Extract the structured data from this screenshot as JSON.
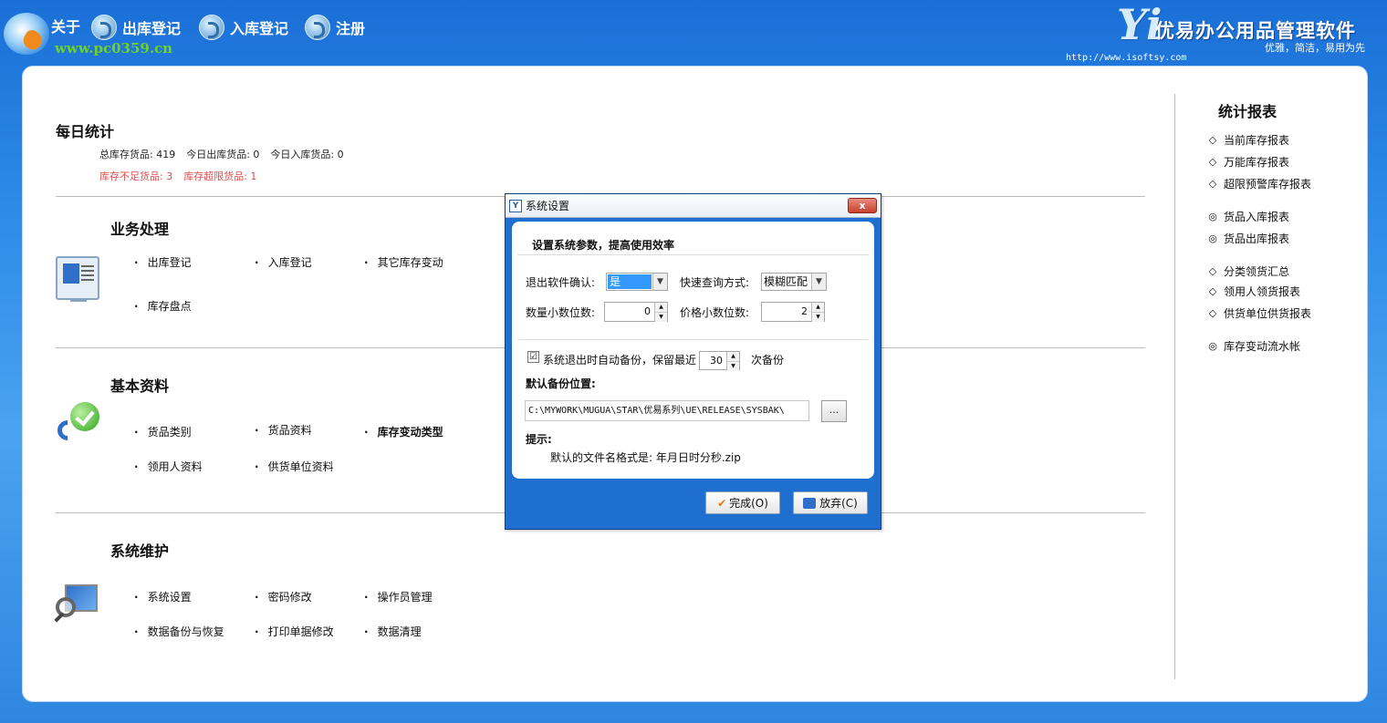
{
  "topbar": {
    "nav": [
      {
        "label": "关于"
      },
      {
        "label": "出库登记"
      },
      {
        "label": "入库登记"
      },
      {
        "label": "注册"
      }
    ],
    "watermark": "www.pc0359.cn",
    "brand": {
      "logo_letter": "Yi",
      "name": "优易办公用品管理软件",
      "slogan": "优雅，简洁，易用为先",
      "url": "http://www.isoftsy.com"
    }
  },
  "daily": {
    "title": "每日统计",
    "line1": [
      "总库存货品: 419",
      "今日出库货品: 0",
      "今日入库货品: 0"
    ],
    "line2": [
      "库存不足货品: 3",
      "库存超限货品: 1"
    ]
  },
  "business": {
    "title": "业务处理",
    "items": [
      "出库登记",
      "入库登记",
      "其它库存变动",
      "库存盘点"
    ]
  },
  "basic": {
    "title": "基本资料",
    "items": [
      "货品类别",
      "货品资料",
      "库存变动类型",
      "领用人资料",
      "供货单位资料"
    ]
  },
  "maintenance": {
    "title": "系统维护",
    "items": [
      "系统设置",
      "密码修改",
      "操作员管理",
      "数据备份与恢复",
      "打印单据修改",
      "数据清理"
    ]
  },
  "reports": {
    "title": "统计报表",
    "items": [
      {
        "mark": "◇",
        "label": "当前库存报表"
      },
      {
        "mark": "◇",
        "label": "万能库存报表"
      },
      {
        "mark": "◇",
        "label": "超限预警库存报表"
      },
      {
        "mark": "◎",
        "label": "货品入库报表"
      },
      {
        "mark": "◎",
        "label": "货品出库报表"
      },
      {
        "mark": "◇",
        "label": "分类领货汇总"
      },
      {
        "mark": "◇",
        "label": "领用人领货报表"
      },
      {
        "mark": "◇",
        "label": "供货单位供货报表"
      },
      {
        "mark": "◎",
        "label": "库存变动流水帐"
      }
    ]
  },
  "dialog": {
    "title": "系统设置",
    "close": "x",
    "subtitle": "设置系统参数，提高使用效率",
    "exit_confirm_label": "退出软件确认:",
    "exit_confirm_value": "是",
    "query_mode_label": "快速查询方式:",
    "query_mode_value": "模糊匹配",
    "qty_decimals_label": "数量小数位数:",
    "qty_decimals_value": "0",
    "price_decimals_label": "价格小数位数:",
    "price_decimals_value": "2",
    "auto_backup_label": "系统退出时自动备份，保留最近",
    "auto_backup_checked": "☑",
    "backup_keep_value": "30",
    "backup_keep_suffix": "次备份",
    "backup_path_label": "默认备份位置:",
    "backup_path_value": "C:\\MYWORK\\MUGUA\\STAR\\优易系列\\UE\\RELEASE\\SYSBAK\\",
    "browse_label": "...",
    "hint_label": "提示:",
    "hint_text": "默认的文件名格式是: 年月日时分秒.zip",
    "ok_label": "完成(O)",
    "cancel_label": "放弃(C)"
  }
}
